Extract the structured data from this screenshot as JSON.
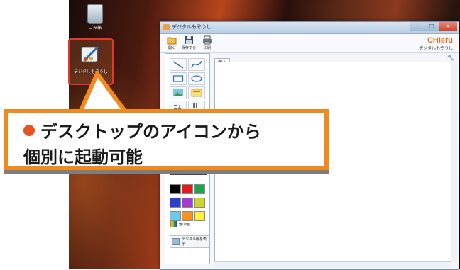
{
  "desktop": {
    "recycle_bin_label": "ごみ箱",
    "app_icon_label": "デジタルもぞうし"
  },
  "window": {
    "title": "デジタルもぞうし",
    "controls": {
      "minimize": "–",
      "maximize": "□",
      "close": "x"
    },
    "toolbar": {
      "open_label": "開く",
      "save_label": "保存する",
      "print_label": "印刷"
    },
    "brand": {
      "name": "CHIeru",
      "subtitle": "デジタルもぞうし"
    },
    "tab_label": "個人",
    "palette": {
      "colors": [
        "#000000",
        "#e21b1b",
        "#1aa64a",
        "#2d3fcf",
        "#a33fcb",
        "#c9d92b",
        "#6ecbe8",
        "#f7931e",
        "#fff23a"
      ],
      "other_color_label": "他の色",
      "toggle_label": "デジタル線を表示"
    }
  },
  "callout": {
    "line1": "デスクトップのアイコンから",
    "line2": "個別に起動可能",
    "accent_color": "#f08a1e"
  }
}
